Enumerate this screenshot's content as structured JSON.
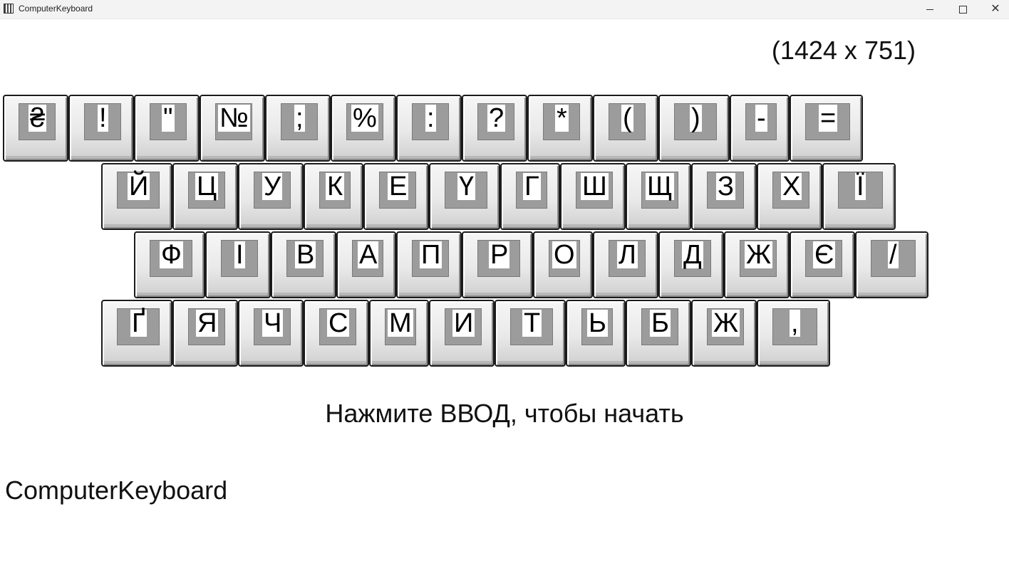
{
  "window": {
    "title": "ComputerKeyboard",
    "minimize_icon": "minimize-icon",
    "maximize_icon": "maximize-icon",
    "close_icon": "close-icon",
    "close_glyph": "✕"
  },
  "resolution_text": "(1424 x 751)",
  "keyboard": {
    "rows": [
      [
        "₴",
        "!",
        "\"",
        "№",
        ";",
        "%",
        ":",
        "?",
        "*",
        "(",
        ")",
        "-",
        "="
      ],
      [
        "Й",
        "Ц",
        "У",
        "К",
        "Е",
        "Ү",
        "Г",
        "Ш",
        "Щ",
        "З",
        "Х",
        "Ї"
      ],
      [
        "Ф",
        "І",
        "В",
        "А",
        "П",
        "Р",
        "О",
        "Л",
        "Д",
        "Ж",
        "Є",
        "/"
      ],
      [
        "Ґ",
        "Я",
        "Ч",
        "С",
        "М",
        "И",
        "Т",
        "Ь",
        "Б",
        "Ж",
        ","
      ]
    ]
  },
  "prompt_text": "Нажмите ВВОД, чтобы начать",
  "app_name": "ComputerKeyboard"
}
